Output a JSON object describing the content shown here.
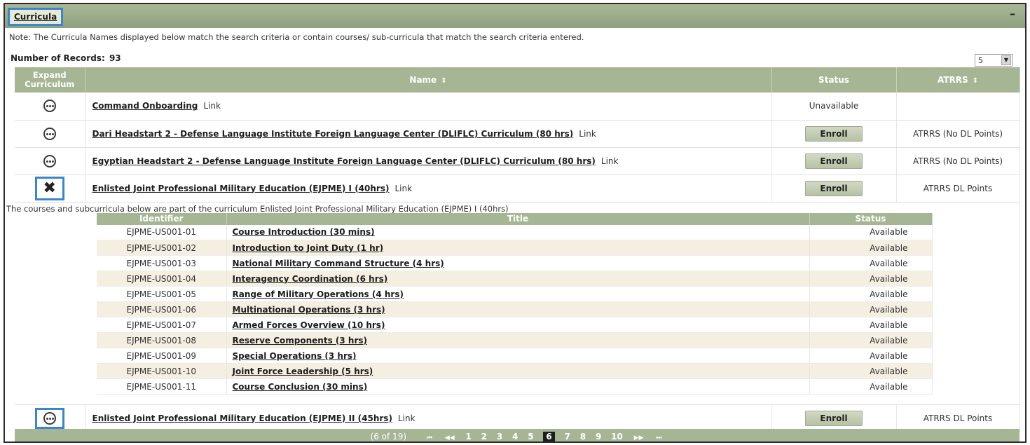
{
  "panel": {
    "title": "Curricula",
    "collapse_symbol": "–",
    "note": "Note: The Curricula Names displayed below match the search criteria or contain courses/ sub-curricula that match the search criteria entered.",
    "records_label": "Number of Records:",
    "records_count": "93",
    "page_size": "5"
  },
  "columns": {
    "expand": "Expand Curriculum",
    "name": "Name",
    "status": "Status",
    "atrrs": "ATRRS",
    "sort_symbol": "⇕"
  },
  "rows": [
    {
      "name": "Command Onboarding",
      "link": "Link",
      "status": "Unavailable",
      "atrrs": ""
    },
    {
      "name": "Dari Headstart 2 - Defense Language Institute Foreign Language Center (DLIFLC) Curriculum (80 hrs)",
      "link": "Link",
      "button": "Enroll",
      "atrrs": "ATRRS (No DL Points)"
    },
    {
      "name": "Egyptian Headstart 2 - Defense Language Institute Foreign Language Center (DLIFLC) Curriculum (80 hrs)",
      "link": "Link",
      "button": "Enroll",
      "atrrs": "ATRRS (No DL Points)"
    },
    {
      "name": "Enlisted Joint Professional Military Education (EJPME) I (40hrs)",
      "link": "Link",
      "button": "Enroll",
      "atrrs": "ATRRS DL Points"
    },
    {
      "name": "Enlisted Joint Professional Military Education (EJPME) II (45hrs)",
      "link": "Link",
      "button": "Enroll",
      "atrrs": "ATRRS DL Points"
    }
  ],
  "expanded": {
    "note": "The courses and subcurricula below are part of the curriculum Enlisted Joint Professional Military Education (EJPME) I (40hrs)",
    "headers": {
      "identifier": "Identifier",
      "title": "Title",
      "status": "Status"
    },
    "courses": [
      {
        "id": "EJPME-US001-01",
        "title": "Course Introduction (30 mins)",
        "status": "Available"
      },
      {
        "id": "EJPME-US001-02",
        "title": "Introduction to Joint Duty (1 hr)",
        "status": "Available"
      },
      {
        "id": "EJPME-US001-03",
        "title": "National Military Command Structure (4 hrs)",
        "status": "Available"
      },
      {
        "id": "EJPME-US001-04",
        "title": "Interagency Coordination (6 hrs)",
        "status": "Available"
      },
      {
        "id": "EJPME-US001-05",
        "title": "Range of Military Operations (4 hrs)",
        "status": "Available"
      },
      {
        "id": "EJPME-US001-06",
        "title": "Multinational Operations (3 hrs)",
        "status": "Available"
      },
      {
        "id": "EJPME-US001-07",
        "title": "Armed Forces Overview (10 hrs)",
        "status": "Available"
      },
      {
        "id": "EJPME-US001-08",
        "title": "Reserve Components (3 hrs)",
        "status": "Available"
      },
      {
        "id": "EJPME-US001-09",
        "title": "Special Operations (3 hrs)",
        "status": "Available"
      },
      {
        "id": "EJPME-US001-10",
        "title": "Joint Force Leadership (5 hrs)",
        "status": "Available"
      },
      {
        "id": "EJPME-US001-11",
        "title": "Course Conclusion (30 mins)",
        "status": "Available"
      }
    ]
  },
  "pager": {
    "count": "(6 of 19)",
    "first": "⏮",
    "prev": "◀◀",
    "next": "▶▶",
    "last": "⏭",
    "pages": [
      "1",
      "2",
      "3",
      "4",
      "5",
      "6",
      "7",
      "8",
      "9",
      "10"
    ],
    "current": "6"
  }
}
